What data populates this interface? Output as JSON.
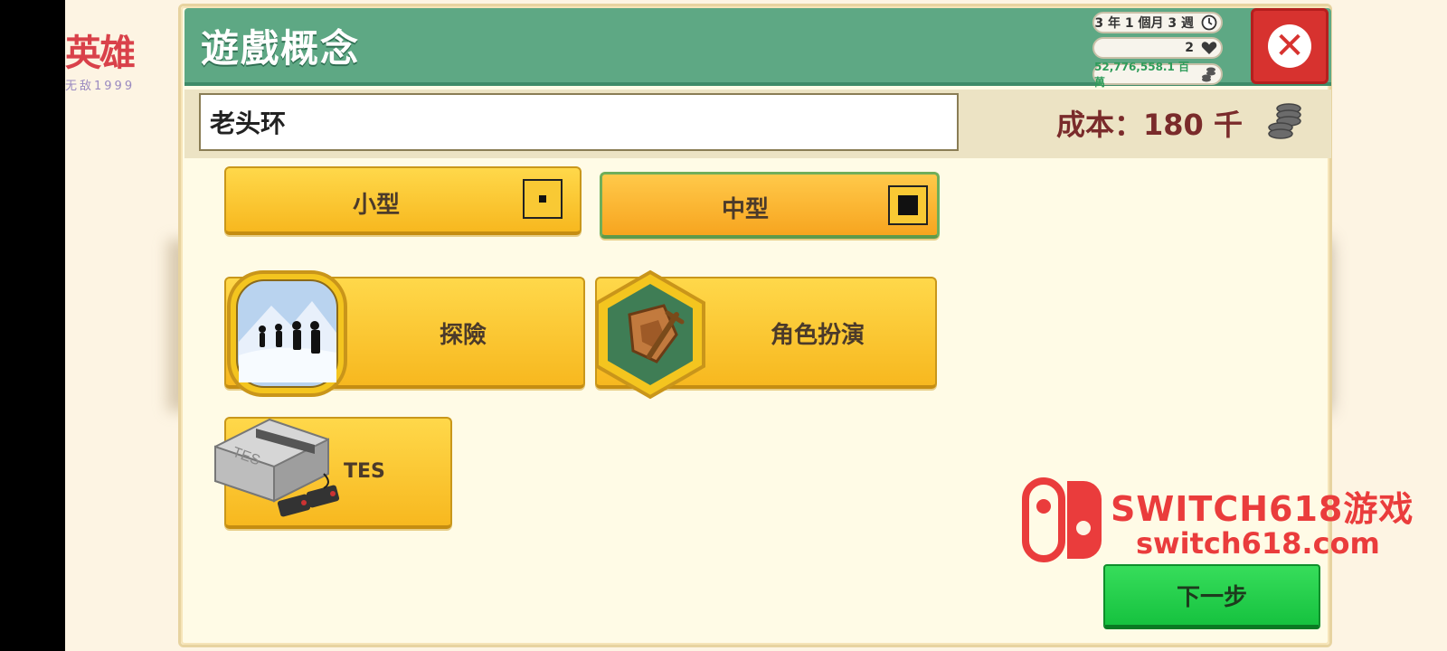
{
  "corner_logo": {
    "line1": "英雄",
    "line2": "无敌1999"
  },
  "header": {
    "title": "遊戲概念"
  },
  "stats": {
    "time": "3 年 1 個月 3 週",
    "fans": "2",
    "money": "52,776,558.1 百萬"
  },
  "icons": {
    "time": "clock-icon",
    "fans": "heart-icon",
    "money": "coins-icon",
    "close": "close-icon",
    "cost": "coin-stack-icon"
  },
  "game_name": {
    "value": "老头环"
  },
  "cost": {
    "label": "成本：180 千"
  },
  "size_options": [
    {
      "label": "小型",
      "selected": false
    },
    {
      "label": "中型",
      "selected": true
    }
  ],
  "genres": [
    {
      "label": "探險",
      "icon": "hikers-icon"
    },
    {
      "label": "角色扮演",
      "icon": "shield-sword-icon"
    }
  ],
  "platform": {
    "label": "TES",
    "icon": "console-icon",
    "console_logo": "TES"
  },
  "next_button": {
    "label": "下一步"
  },
  "watermark": {
    "title": "SWITCH618游戏",
    "url": "switch618.com"
  },
  "colors": {
    "header_green": "#5ea884",
    "button_yellow": "#ffd84a",
    "next_green": "#16c23f",
    "close_red": "#d7322f",
    "cost_text": "#7a2b2b"
  }
}
